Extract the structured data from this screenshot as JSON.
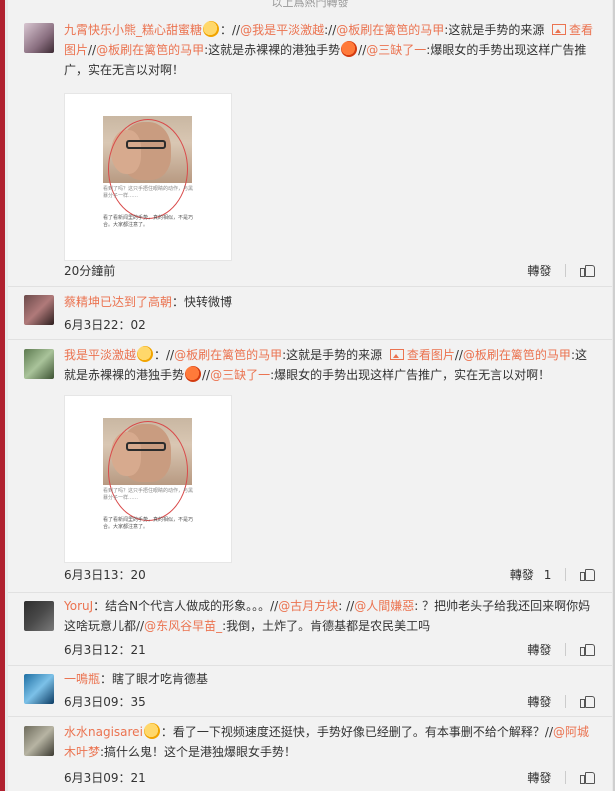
{
  "top_notice": "以上爲熱門轉發",
  "action_labels": {
    "repost": "轉發"
  },
  "items": [
    {
      "user": "九霄快乐小熊_糕心甜蜜糖",
      "seg1": "：//",
      "m1": "@我是平淡激越",
      "t1": "://",
      "m2": "@板刷在篱笆的马甲",
      "t2": ":这就是手势的来源",
      "view_pic": "查看图片",
      "t3": "//",
      "m3": "@板刷在篱笆的马甲",
      "t4": ":这就是赤裸裸的港独手势",
      "t5": "//",
      "m4": "@三缺了一",
      "t6": ":爆眼女的手势出现这样广告推广，实在无言以对啊！",
      "time": "20分鐘前",
      "repost_count": ""
    },
    {
      "user": "蔡精坤已达到了高朝",
      "text": "：快转微博",
      "time": "6月3日22：02"
    },
    {
      "user": "我是平淡激越",
      "seg1": "：//",
      "m1": "@板刷在篱笆的马甲",
      "t1": ":这就是手势的来源",
      "view_pic": "查看图片",
      "t2": "//",
      "m2": "@板刷在篱笆的马甲",
      "t3": ":这就是赤裸裸的港独手势",
      "t4": "//",
      "m3": "@三缺了一",
      "t5": ":爆眼女的手势出现这样广告推广，实在无言以对啊！",
      "time": "6月3日13：20",
      "repost_count": "1"
    },
    {
      "user": "YoruJ",
      "t0": "：结合N个代言人做成的形象。。。//",
      "m1": "@古月方块",
      "t1": ": //",
      "m2": "@人間嫌惡",
      "t2": ": ？把帅老头子给我还回来啊你妈这啥玩意儿都//",
      "m3": "@东风谷早苗_",
      "t3": ":我倒，土炸了。肯德基都是农民美工吗",
      "time": "6月3日12：21"
    },
    {
      "user": "一鳴瓶",
      "text": "：瞎了眼才吃肯德基",
      "time": "6月3日09：35"
    },
    {
      "user": "水水nagisarei",
      "t0": "：看了一下视频速度还挺快，手势好像已经删了。有本事删不给个解释？//",
      "m1": "@阿城木叶梦",
      "t1": ":搞什么鬼！这个是港独爆眼女手势！",
      "time": "6月3日09：21"
    }
  ],
  "thumbnail": {
    "caption_top": "看到了吗？这只手捂住眼睛的动作，与黑暴分子一样……",
    "caption_bottom": "看了看新闻里的手势，真的相似，不是巧合。大家都注意了。"
  }
}
